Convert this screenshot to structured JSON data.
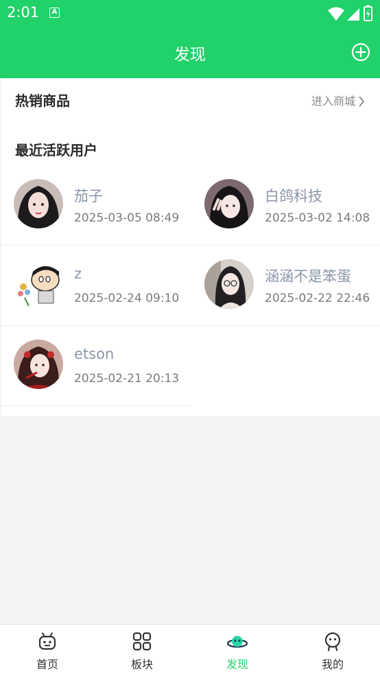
{
  "status_bar": {
    "time": "2:01",
    "notification": "A"
  },
  "header": {
    "title": "发现"
  },
  "hot": {
    "title": "热销商品",
    "link": "进入商城"
  },
  "active_users": {
    "title": "最近活跃用户",
    "users": [
      {
        "name": "茄子",
        "time": "2025-03-05 08:49"
      },
      {
        "name": "白鸽科技",
        "time": "2025-03-02 14:08"
      },
      {
        "name": "z",
        "time": "2025-02-24 09:10"
      },
      {
        "name": "涵涵不是笨蛋",
        "time": "2025-02-22 22:46"
      },
      {
        "name": "etson",
        "time": "2025-02-21 20:13"
      }
    ]
  },
  "tabbar": {
    "tabs": [
      {
        "label": "首页",
        "icon": "robot-home-icon"
      },
      {
        "label": "板块",
        "icon": "grid-icon"
      },
      {
        "label": "发现",
        "icon": "planet-icon",
        "active": true
      },
      {
        "label": "我的",
        "icon": "profile-icon"
      }
    ]
  },
  "colors": {
    "brand": "#21d16a",
    "name_text": "#8a96a8",
    "time_text": "#7b7b7b"
  }
}
